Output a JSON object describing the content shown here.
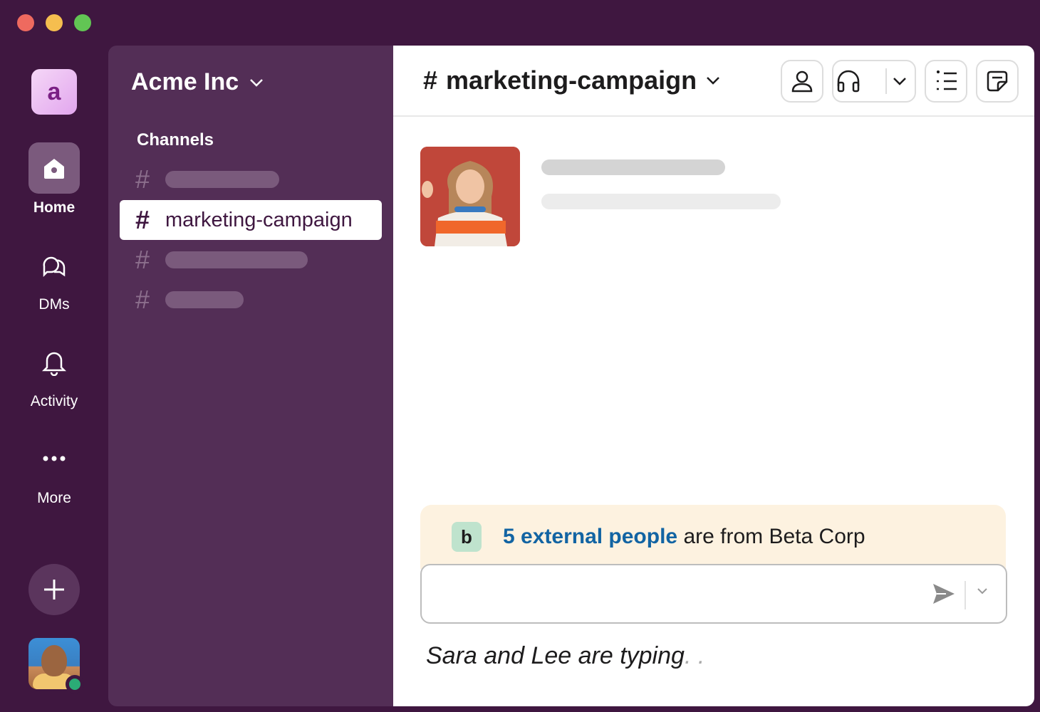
{
  "window": {
    "controls": [
      "close",
      "minimize",
      "zoom"
    ]
  },
  "rail": {
    "workspace_initial": "a",
    "items": [
      {
        "label": "Home",
        "icon": "home-icon",
        "active": true
      },
      {
        "label": "DMs",
        "icon": "dms-icon",
        "active": false
      },
      {
        "label": "Activity",
        "icon": "bell-icon",
        "active": false
      },
      {
        "label": "More",
        "icon": "more-icon",
        "active": false
      }
    ],
    "add_icon": "plus-icon",
    "user_status": "online"
  },
  "sidebar": {
    "workspace_name": "Acme Inc",
    "section_title": "Channels",
    "channels": [
      {
        "name": "",
        "placeholder": true
      },
      {
        "name": "marketing-campaign",
        "active": true
      },
      {
        "name": "",
        "placeholder": true
      },
      {
        "name": "",
        "placeholder": true
      }
    ],
    "hash": "#"
  },
  "main": {
    "channel_hash": "#",
    "channel_title": "marketing-campaign",
    "header_buttons": [
      "members-icon",
      "huddle-headphones-icon",
      "channel-list-icon",
      "canvas-icon"
    ],
    "external_banner": {
      "badge": "b",
      "link_text": "5 external people",
      "rest_text": " are from Beta Corp"
    },
    "composer": {
      "placeholder": "",
      "send_icon": "send-icon"
    },
    "typing_text": "Sara and Lee are typing",
    "typing_dots": ". ."
  },
  "colors": {
    "aubergine": "#3f1740",
    "sidebar": "#532e56",
    "link": "#1264a3",
    "banner": "#fdf2e0",
    "online": "#2bac76"
  }
}
